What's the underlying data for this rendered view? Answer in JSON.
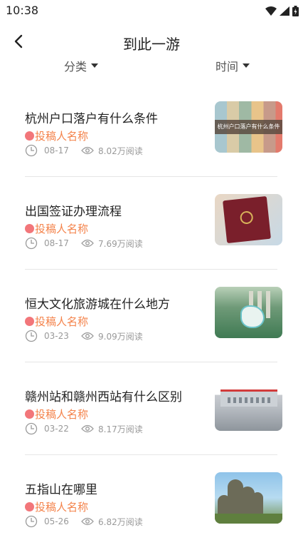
{
  "status_bar": {
    "time": "10:38"
  },
  "nav": {
    "title": "到此一游"
  },
  "filters": {
    "category": "分类",
    "time": "时间"
  },
  "articles": [
    {
      "title": "杭州户口落户有什么条件",
      "author": "投稿人名称",
      "date": "08-17",
      "views": "8.02万阅读",
      "thumb_caption": "杭州户口落户有什么条件"
    },
    {
      "title": "出国签证办理流程",
      "author": "投稿人名称",
      "date": "08-17",
      "views": "7.69万阅读"
    },
    {
      "title": "恒大文化旅游城在什么地方",
      "author": "投稿人名称",
      "date": "03-23",
      "views": "9.09万阅读"
    },
    {
      "title": "赣州站和赣州西站有什么区别",
      "author": "投稿人名称",
      "date": "03-22",
      "views": "8.17万阅读"
    },
    {
      "title": "五指山在哪里",
      "author": "投稿人名称",
      "date": "05-26",
      "views": "6.82万阅读"
    }
  ],
  "colors": {
    "author": "#f4834b",
    "author_dot": "#f2767a",
    "meta": "#999999",
    "divider": "#e6e6e6"
  }
}
